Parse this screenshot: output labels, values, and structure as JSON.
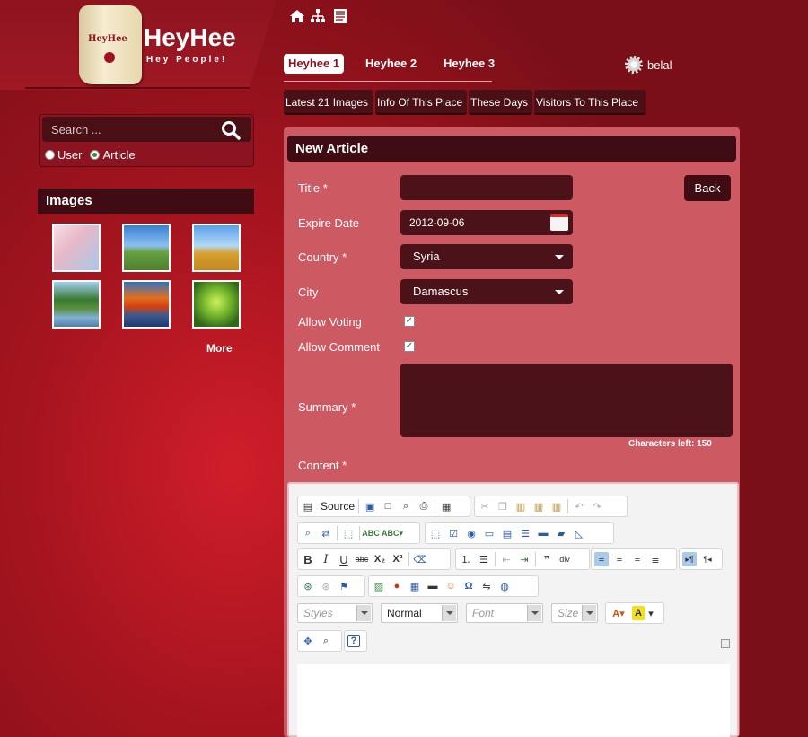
{
  "brand": {
    "scroll_text": "HeyHee",
    "name": "HeyHee",
    "tagline": "Hey People!"
  },
  "top_icons": [
    "home-icon",
    "sitemap-icon",
    "document-icon"
  ],
  "tabs": [
    {
      "label": "Heyhee 1",
      "active": true
    },
    {
      "label": "Heyhee 2",
      "active": false
    },
    {
      "label": "Heyhee 3",
      "active": false
    }
  ],
  "user": {
    "name": "belal"
  },
  "subtabs": [
    {
      "label": "Latest 21 Images"
    },
    {
      "label": "Info Of This Place"
    },
    {
      "label": "These Days"
    },
    {
      "label": "Visitors To This Place"
    }
  ],
  "search": {
    "placeholder": "Search ...",
    "options": [
      {
        "label": "User",
        "checked": false
      },
      {
        "label": "Article",
        "checked": true
      }
    ]
  },
  "images_section": {
    "title": "Images",
    "more_label": "More",
    "thumbs": [
      "cherry-blossom",
      "green-field",
      "hay-field",
      "lake-trees",
      "autumn-lake",
      "green-forest"
    ]
  },
  "form": {
    "title": "New Article",
    "back_label": "Back",
    "title_label": "Title *",
    "title_value": "",
    "expire_label": "Expire Date",
    "expire_value": "2012-09-06",
    "country_label": "Country *",
    "country_value": "Syria",
    "city_label": "City",
    "city_value": "Damascus",
    "voting_label": "Allow Voting",
    "voting_checked": true,
    "comment_label": "Allow Comment",
    "comment_checked": true,
    "summary_label": "Summary *",
    "chars_left": "Characters left: 150",
    "content_label": "Content *"
  },
  "editor": {
    "source_label": "Source",
    "styles_placeholder": "Styles",
    "format_value": "Normal",
    "font_placeholder": "Font",
    "size_placeholder": "Size"
  },
  "colors": {
    "bg_red": "#a5141f",
    "panel": "#cd5a63",
    "dark": "#3f0c13"
  }
}
